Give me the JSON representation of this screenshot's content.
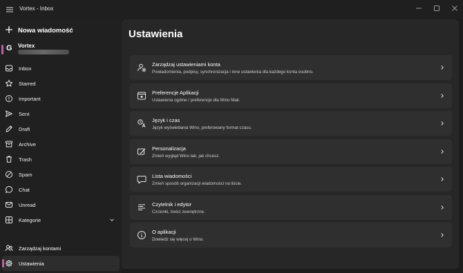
{
  "window": {
    "title": "Vortex - Inbox"
  },
  "sidebar": {
    "new_mail_label": "Nowa wiadomość",
    "account": {
      "avatar_letter": "G",
      "name": "Vortex"
    },
    "folders": [
      {
        "label": "Inbox",
        "icon": "inbox-icon"
      },
      {
        "label": "Starred",
        "icon": "star-icon"
      },
      {
        "label": "Important",
        "icon": "important-icon"
      },
      {
        "label": "Sent",
        "icon": "send-icon"
      },
      {
        "label": "Draft",
        "icon": "draft-icon"
      },
      {
        "label": "Archive",
        "icon": "archive-icon"
      },
      {
        "label": "Trash",
        "icon": "trash-icon"
      },
      {
        "label": "Spam",
        "icon": "spam-icon"
      },
      {
        "label": "Chat",
        "icon": "chat-icon"
      },
      {
        "label": "Unread",
        "icon": "unread-icon"
      },
      {
        "label": "Kategorie",
        "icon": "category-icon"
      }
    ],
    "bottom": [
      {
        "label": "Zarządzaj kontami",
        "icon": "people-icon"
      },
      {
        "label": "Ustawienia",
        "icon": "gear-icon"
      }
    ]
  },
  "main": {
    "title": "Ustawienia",
    "cards": [
      {
        "title": "Zarządzaj ustawieniami konta",
        "subtitle": "Powiadomienia, podpisy, synchronizacja i inne ustawienia dla każdego konta osobno.",
        "icon": "account-settings-icon"
      },
      {
        "title": "Preferencje Aplikacji",
        "subtitle": "Ustawienia ogólne / preferencje dla Wino Mail.",
        "icon": "app-preferences-icon"
      },
      {
        "title": "Język i czas",
        "subtitle": "Język wyświetlania Wino, preferowany format czasu.",
        "icon": "language-icon"
      },
      {
        "title": "Personalizacja",
        "subtitle": "Zmień wygląd Wino tak, jak chcesz.",
        "icon": "personalization-icon"
      },
      {
        "title": "Lista wiadomości",
        "subtitle": "Zmień sposób organizacji wiadomości na liście.",
        "icon": "message-list-icon"
      },
      {
        "title": "Czytelnik i edytor",
        "subtitle": "Czcionki, treści zewnętrzne.",
        "icon": "reader-icon"
      },
      {
        "title": "O aplikacji",
        "subtitle": "Dowiedz się więcej o Wino.",
        "icon": "info-icon"
      }
    ]
  },
  "colors": {
    "accent": "#c25fa0",
    "background": "#1c1c1c",
    "card": "#2f2f2f",
    "panel": "#272727"
  }
}
